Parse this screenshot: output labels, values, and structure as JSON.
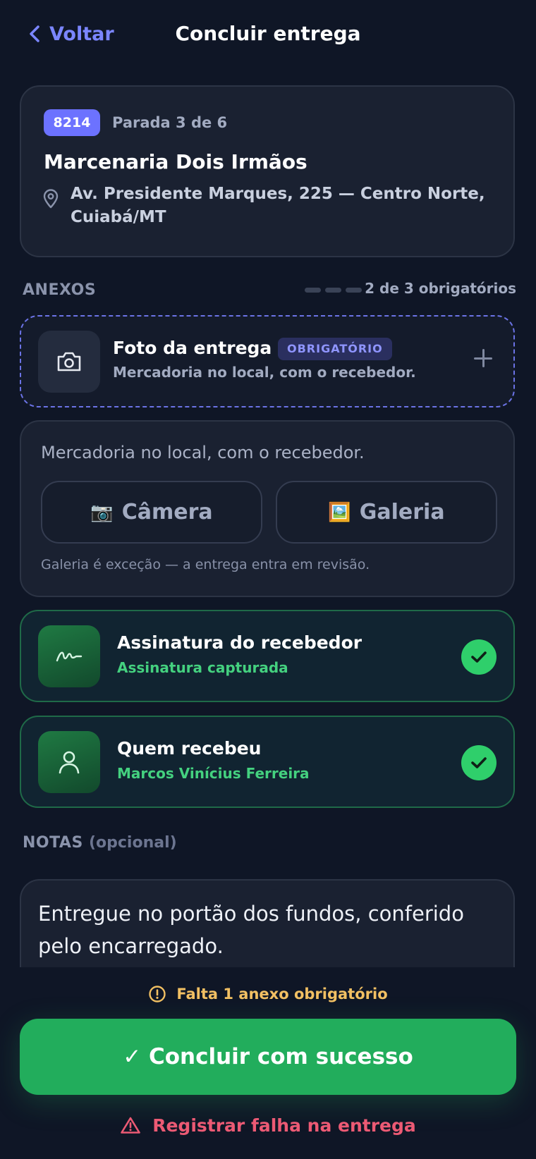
{
  "header": {
    "back_label": "Voltar",
    "title": "Concluir entrega"
  },
  "stop": {
    "code": "8214",
    "position": "Parada 3 de 6",
    "name": "Marcenaria Dois Irmãos",
    "address": "Av. Presidente Marques, 225 — Centro Norte, Cuiabá/MT"
  },
  "attachments": {
    "section_title": "ANEXOS",
    "required_progress": "2 de 3 obrigatórios",
    "photo": {
      "title": "Foto da entrega",
      "badge": "OBRIGATÓRIO",
      "subtitle": "Mercadoria no local, com o recebedor."
    },
    "source": {
      "hint": "Mercadoria no local, com o recebedor.",
      "camera_label": "Câmera",
      "camera_glyph": "📷",
      "gallery_label": "Galeria",
      "gallery_glyph": "🖼️",
      "note": "Galeria é exceção — a entrega entra em revisão."
    },
    "signature": {
      "title": "Assinatura do recebedor",
      "subtitle": "Assinatura capturada",
      "status": "done"
    },
    "receiver": {
      "title": "Quem recebeu",
      "subtitle": "Marcos Vinícius Ferreira",
      "status": "done"
    }
  },
  "notes": {
    "section_title": "NOTAS",
    "optional_label": "(opcional)",
    "text": "Entregue no portão dos fundos, conferido pelo encarregado."
  },
  "footer": {
    "warning": "Falta 1 anexo obrigatório",
    "primary_label": "✓ Concluir com sucesso",
    "fail_label": "Registrar falha na entrega"
  },
  "colors": {
    "accent": "#6c72ff",
    "success": "#22ad5c",
    "warning": "#f2c063",
    "danger": "#ec5a74",
    "background": "#0f1626"
  }
}
